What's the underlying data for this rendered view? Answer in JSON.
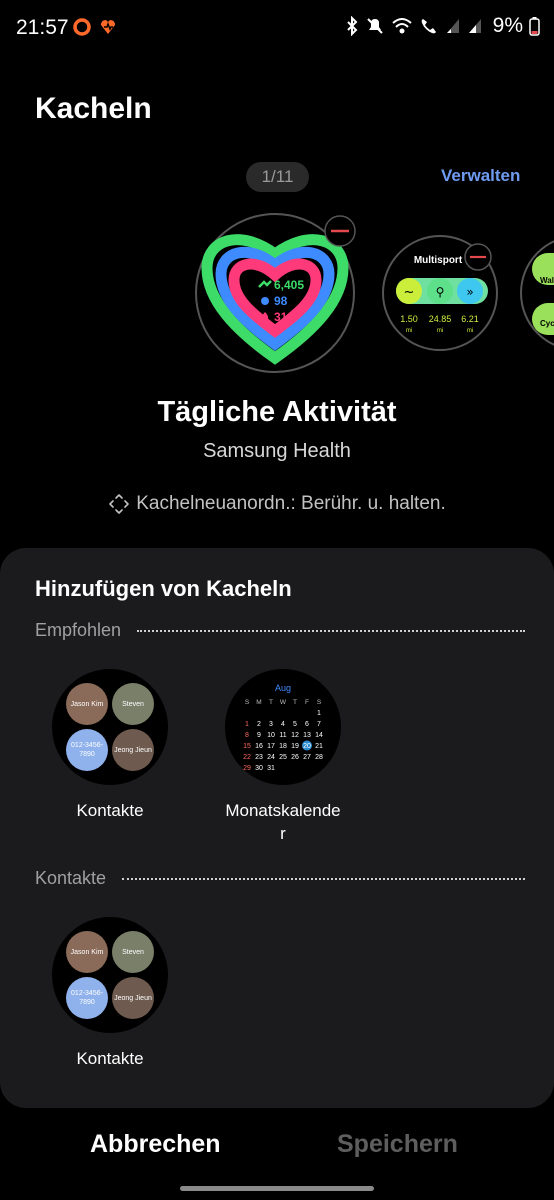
{
  "status_bar": {
    "time": "21:57",
    "battery": "9%"
  },
  "header": {
    "title": "Kacheln"
  },
  "carousel": {
    "pager": "1/11",
    "manage_label": "Verwalten",
    "activity_tile": {
      "steps": "6,405",
      "minutes": "98",
      "calories": "310"
    },
    "multisport_tile": {
      "title": "Multisport",
      "stats": [
        {
          "value": "1.50",
          "unit": "mi"
        },
        {
          "value": "24.85",
          "unit": "mi"
        },
        {
          "value": "6.21",
          "unit": "mi"
        }
      ]
    },
    "partial_tile": {
      "item1": "Wal",
      "item2": "Cyc"
    }
  },
  "selected_tile": {
    "title": "Tägliche Aktivität",
    "subtitle": "Samsung Health",
    "hint": "Kachelneuanordn.: Berühr. u. halten."
  },
  "add_sheet": {
    "title": "Hinzufügen von Kacheln",
    "sections": [
      {
        "label": "Empfohlen",
        "tiles": [
          {
            "label": "Kontakte"
          },
          {
            "label": "Monatskalender"
          }
        ]
      },
      {
        "label": "Kontakte",
        "tiles": [
          {
            "label": "Kontakte"
          }
        ]
      }
    ],
    "contacts": [
      "Jason Kim",
      "Steven",
      "012-3456-7890",
      "Jeong Jieun"
    ],
    "calendar": {
      "month": "Aug",
      "weekdays": [
        "S",
        "M",
        "T",
        "W",
        "T",
        "F",
        "S"
      ],
      "weeks": [
        [
          "",
          "",
          "",
          "",
          "",
          "",
          "1"
        ],
        [
          "1",
          "2",
          "3",
          "4",
          "5",
          "6",
          "7"
        ],
        [
          "8",
          "9",
          "10",
          "11",
          "12",
          "13",
          "14"
        ],
        [
          "15",
          "16",
          "17",
          "18",
          "19",
          "20",
          "21"
        ],
        [
          "22",
          "23",
          "24",
          "25",
          "26",
          "27",
          "28"
        ],
        [
          "29",
          "30",
          "31",
          "",
          "",
          "",
          ""
        ]
      ],
      "today": "20"
    }
  },
  "bottom_bar": {
    "cancel_label": "Abbrechen",
    "save_label": "Speichern"
  },
  "colors": {
    "accent_link": "#6f9bf0",
    "remove_badge": "#e5484d",
    "ring_green": "#3ddc69",
    "ring_blue": "#3e8bff",
    "ring_pink": "#ff3a7a"
  }
}
